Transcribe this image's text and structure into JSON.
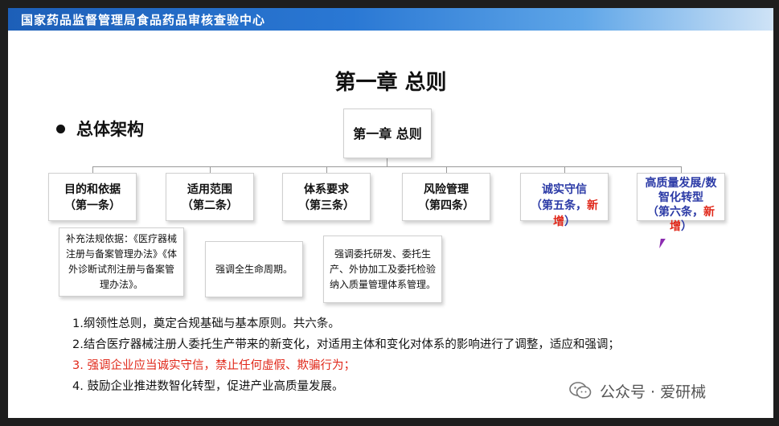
{
  "banner": {
    "text": "国家药品监督管理局食品药品审核查验中心"
  },
  "slide": {
    "title": "第一章 总则",
    "section": "总体架构",
    "root_box": "第一章 总则",
    "categories": [
      {
        "line1": "目的和依据",
        "line2": "（第一条）"
      },
      {
        "line1": "适用范围",
        "line2": "（第二条）"
      },
      {
        "line1": "体系要求",
        "line2": "（第三条）"
      },
      {
        "line1": "风险管理",
        "line2": "（第四条）"
      },
      {
        "line1": "诚实守信",
        "line2_a": "（第五条，",
        "line2_b": "新增",
        "line2_c": "）"
      },
      {
        "line1": "高质量发展/数智化转型",
        "line2_a": "（第六条，",
        "line2_b": "新增",
        "line2_c": "）"
      }
    ],
    "details": [
      "补充法规依据：《医疗器械注册与备案管理办法》《体外诊断试剂注册与备案管理办法》。",
      "强调全生命周期。",
      "强调委托研发、委托生产、外协加工及委托检验纳入质量管理体系管理。"
    ],
    "notes": [
      "1.纲领性总则，奠定合规基础与基本原则。共六条。",
      "2.结合医疗器械注册人委托生产带来的新变化，对适用主体和变化对体系的影响进行了调整，适应和强调；",
      "3. 强调企业应当诚实守信，禁止任何虚假、欺骗行为；",
      "4. 鼓励企业推进数智化转型，促进产业高质量发展。"
    ]
  },
  "watermark": {
    "text": "公众号 · 爱研械",
    "icon": "wechat-icon"
  },
  "colors": {
    "banner": "#2a78d4",
    "highlight_red": "#e0281a",
    "highlight_blue": "#2b3aa6"
  }
}
